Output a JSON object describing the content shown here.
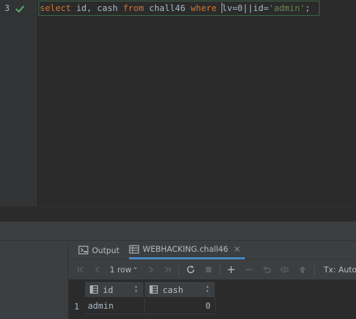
{
  "editor": {
    "line_number": "3",
    "tokens": {
      "kw_select": "select",
      "t1": " id, cash ",
      "kw_from": "from",
      "t2": " chall46 ",
      "kw_where": "where",
      "t3": " ",
      "t4": "lv=0||id=",
      "str_admin": "'admin'",
      "t5": ";"
    }
  },
  "tabs": {
    "output_label": "Output",
    "table_label": "WEBHACKING.chall46",
    "close_glyph": "×"
  },
  "toolbar": {
    "rows_label": "1 row",
    "rows_caret": "⌄",
    "tx_label": "Tx: Auto ⌄"
  },
  "grid": {
    "columns": [
      "id",
      "cash"
    ],
    "rows": [
      {
        "num": "1",
        "id": "admin",
        "cash": "0"
      }
    ]
  },
  "colors": {
    "background": "#2b2b2b",
    "keyword": "#cc7832",
    "string": "#6a8759",
    "check": "#59a869",
    "accent": "#4a88c7"
  }
}
